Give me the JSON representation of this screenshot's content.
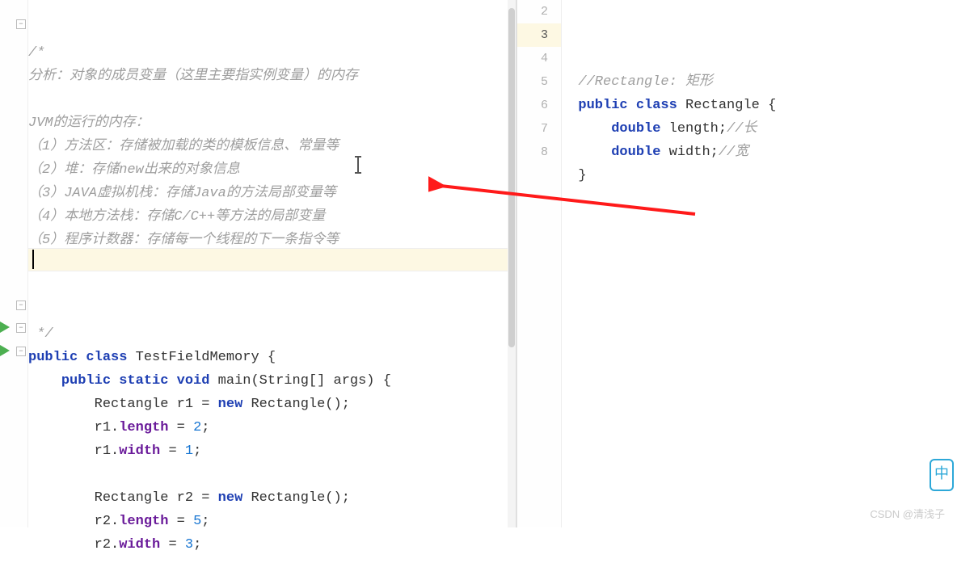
{
  "left_editor": {
    "comment_open": "/*",
    "analysis_line": "分析：对象的成员变量（这里主要指实例变量）的内存",
    "jvm_title": "JVM的运行的内存：",
    "jvm_1": "（1）方法区：存储被加载的类的模板信息、常量等",
    "jvm_2": "（2）堆：存储new出来的对象信息",
    "jvm_3": "（3）JAVA虚拟机栈：存储Java的方法局部变量等",
    "jvm_4": "（4）本地方法栈：存储C/C++等方法的局部变量",
    "jvm_5": "（5）程序计数器：存储每一个线程的下一条指令等",
    "comment_close": " */",
    "class_decl_public": "public",
    "class_decl_class": "class",
    "class_name": "TestFieldMemory",
    "main_public": "public",
    "main_static": "static",
    "main_void": "void",
    "main_name": "main",
    "main_args": "(String[] args) {",
    "r1_decl_type": "Rectangle",
    "r1_decl_name": "r1 = ",
    "r1_new": "new",
    "r1_ctor": " Rectangle();",
    "r1_length": "r1.",
    "r1_length_field": "length",
    "r1_length_val": " = 2;",
    "r1_width": "r1.",
    "r1_width_field": "width",
    "r1_width_val": " = 1;",
    "r2_decl_type": "Rectangle",
    "r2_decl_name": "r2 = ",
    "r2_new": "new",
    "r2_ctor": " Rectangle();",
    "r2_length": "r2.",
    "r2_length_field": "length",
    "r2_length_val": " = 5;",
    "r2_width": "r2.",
    "r2_width_field": "width",
    "r2_width_val": " = 3;"
  },
  "right_editor": {
    "lines": {
      "l2": "2",
      "l3": "3",
      "l4": "4",
      "l5": "5",
      "l6": "6",
      "l7": "7",
      "l8": "8"
    },
    "comment": "//Rectangle: 矩形",
    "public": "public",
    "class_kw": "class",
    "class_name": "Rectangle",
    "double1": "double",
    "field1": "length",
    "comment1": "//长",
    "double2": "double",
    "field2": "width",
    "comment2": "//宽",
    "close": "}"
  },
  "watermark": "CSDN @清浅子",
  "badge_char": "中"
}
